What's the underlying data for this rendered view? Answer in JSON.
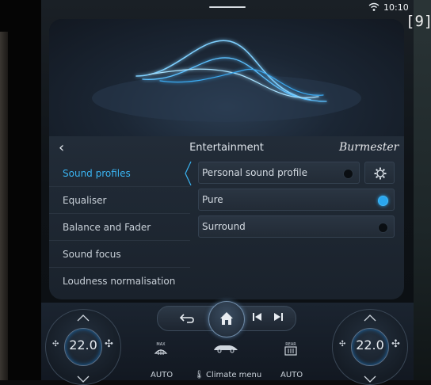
{
  "status_bar": {
    "time": "10:10"
  },
  "badge": "[9]",
  "panel": {
    "title": "Entertainment",
    "brand": "Burmester",
    "sidebar": [
      {
        "label": "Sound profiles",
        "active": true
      },
      {
        "label": "Equaliser",
        "active": false
      },
      {
        "label": "Balance and Fader",
        "active": false
      },
      {
        "label": "Sound focus",
        "active": false
      },
      {
        "label": "Loudness normalisation",
        "active": false
      }
    ],
    "options": [
      {
        "label": "Personal sound profile",
        "selected": false
      },
      {
        "label": "Pure",
        "selected": true
      },
      {
        "label": "Surround",
        "selected": false
      }
    ]
  },
  "climate": {
    "left_temp": "22.0",
    "right_temp": "22.0",
    "left_label": "AUTO",
    "center_label": "Climate menu",
    "right_label": "AUTO",
    "max_label": "MAX",
    "rear_label": "REAR"
  },
  "colors": {
    "accent": "#2aa6ee",
    "text": "#d3dae1"
  }
}
